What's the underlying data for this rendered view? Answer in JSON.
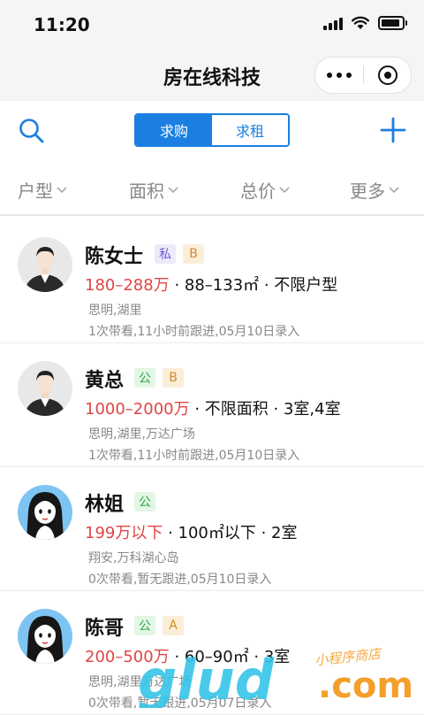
{
  "status_bar": {
    "time": "11:20"
  },
  "nav": {
    "title": "房在线科技"
  },
  "toolbar": {
    "segments": [
      {
        "label": "求购",
        "active": true
      },
      {
        "label": "求租",
        "active": false
      }
    ]
  },
  "filters": [
    {
      "label": "户型"
    },
    {
      "label": "面积"
    },
    {
      "label": "总价"
    },
    {
      "label": "更多"
    }
  ],
  "clients": [
    {
      "name": "陈女士",
      "tags": [
        "私",
        "B"
      ],
      "price": "180–288万",
      "details": " · 88–133㎡ · 不限户型",
      "location": "思明,湖里",
      "meta": "1次带看,11小时前跟进,05月10日录入",
      "avatar": "male-avatar"
    },
    {
      "name": "黄总",
      "tags": [
        "公",
        "B"
      ],
      "price": "1000–2000万",
      "details": " · 不限面积 · 3室,4室",
      "location": "思明,湖里,万达广场",
      "meta": "1次带看,11小时前跟进,05月10日录入",
      "avatar": "male-avatar"
    },
    {
      "name": "林姐",
      "tags": [
        "公"
      ],
      "price": "199万以下",
      "details": " · 100㎡以下 · 2室",
      "location": "翔安,万科湖心岛",
      "meta": "0次带看,暂无跟进,05月10日录入",
      "avatar": "female-avatar"
    },
    {
      "name": "陈哥",
      "tags": [
        "公",
        "A"
      ],
      "price": "200–500万",
      "details": " · 60–90㎡ · 3室",
      "location": "思明,湖里万达广场",
      "meta": "0次带看,暂无跟进,05月07日录入",
      "avatar": "female-avatar"
    }
  ],
  "watermark": {
    "logo": "glud.com",
    "caption": "小程序商店"
  },
  "colors": {
    "accent": "#1a7fe0",
    "price": "#e04545",
    "tag_private": "#6b5fd0",
    "tag_public": "#2aa74a",
    "tag_grade": "#d48a2a"
  }
}
